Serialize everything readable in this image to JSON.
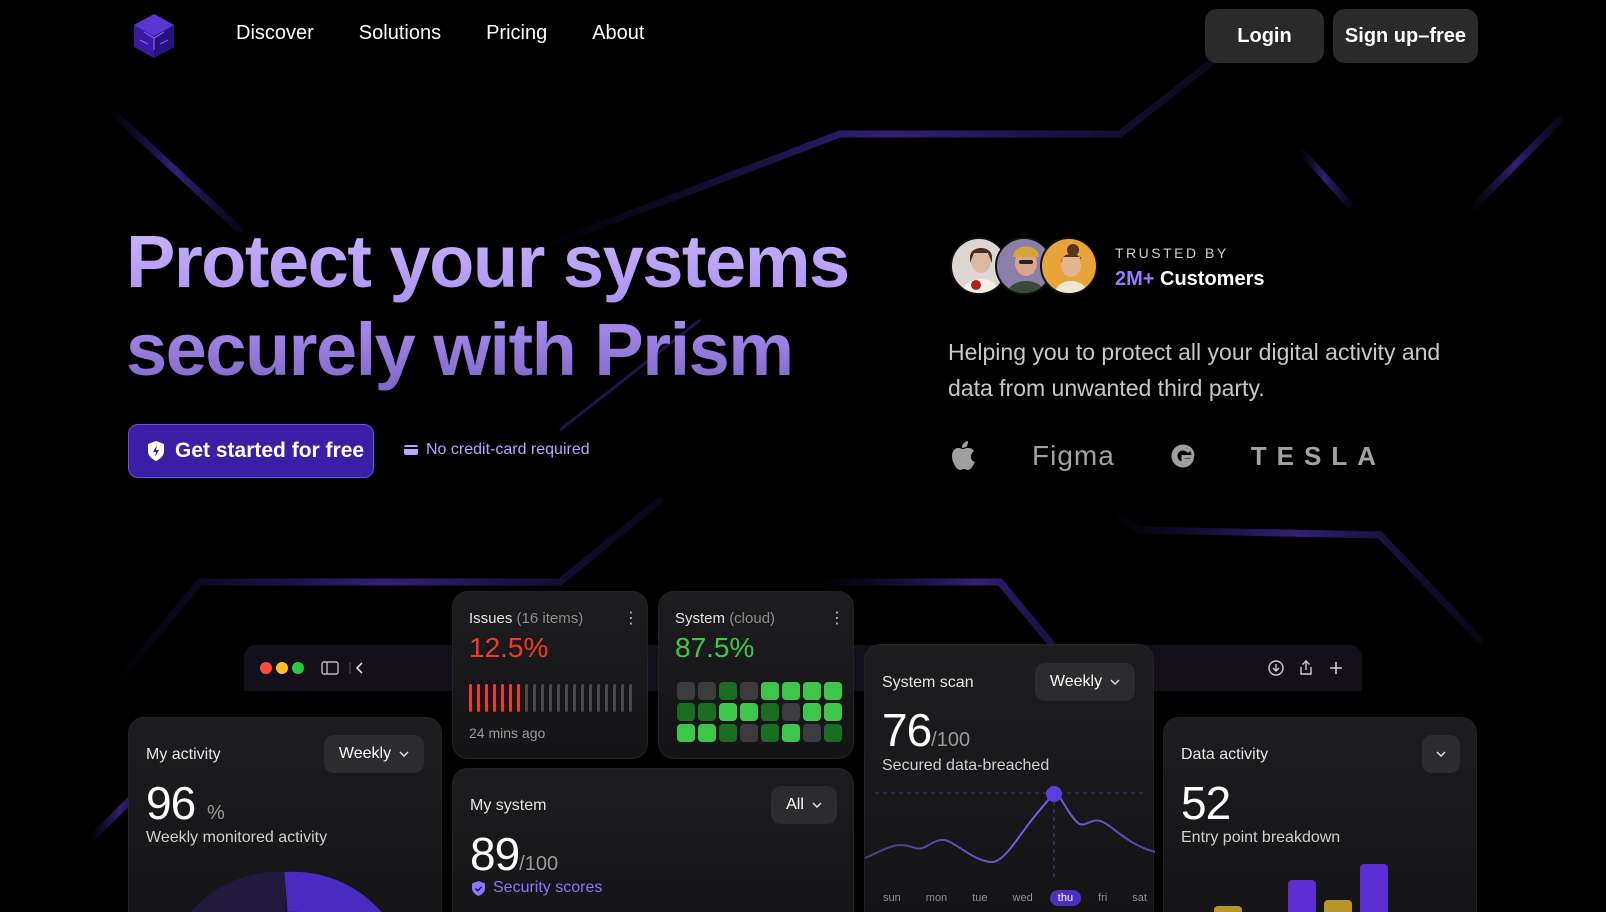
{
  "nav": {
    "links": [
      "Discover",
      "Solutions",
      "Pricing",
      "About"
    ],
    "login": "Login",
    "signup": "Sign up–free"
  },
  "hero": {
    "title_line1": "Protect your systems",
    "title_line2": "securely with Prism",
    "cta": "Get started for free",
    "no_card": "No credit-card required",
    "trusted_label": "TRUSTED BY",
    "trusted_count": "2M+",
    "trusted_suffix": " Customers",
    "description": "Helping you to protect all your digital activity and data from unwanted third party.",
    "brands": [
      "apple-logo",
      "Figma",
      "google-logo",
      "TESLA"
    ]
  },
  "cards": {
    "issues": {
      "title": "Issues",
      "count": "(16 items)",
      "value": "12.5%",
      "time": "24 mins ago",
      "active_ticks": 7,
      "total_ticks": 21
    },
    "system": {
      "title": "System",
      "tag": "(cloud)",
      "value": "87.5%"
    },
    "scan": {
      "title": "System scan",
      "filter": "Weekly",
      "value": "76",
      "max": "/100",
      "subtitle": "Secured data-breached",
      "days": [
        "sun",
        "mon",
        "tue",
        "wed",
        "thu",
        "fri",
        "sat"
      ],
      "active_day": "thu"
    },
    "activity": {
      "title": "My activity",
      "filter": "Weekly",
      "value": "96",
      "unit": "%",
      "subtitle": "Weekly monitored activity"
    },
    "my_system": {
      "title": "My system",
      "filter": "All",
      "value": "89",
      "max": "/100",
      "subtitle": "Security scores"
    },
    "data_activity": {
      "title": "Data activity",
      "value": "52",
      "subtitle": "Entry point breakdown"
    }
  },
  "colors": {
    "accent": "#3a1fa6",
    "red": "#f0392b",
    "green": "#3ec64a",
    "gold": "#b8962a",
    "purple": "#5b2fd1"
  }
}
